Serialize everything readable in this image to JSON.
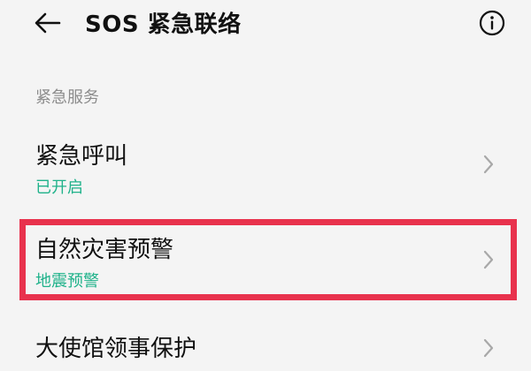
{
  "header": {
    "title": "SOS 紧急联络",
    "back_icon": "arrow-left-icon",
    "info_icon": "info-circle-icon"
  },
  "section": {
    "label": "紧急服务"
  },
  "items": [
    {
      "title": "紧急呼叫",
      "subtitle": "已开启",
      "icon": "chevron-right-icon"
    },
    {
      "title": "自然灾害预警",
      "subtitle": "地震预警",
      "icon": "chevron-right-icon",
      "highlighted": true
    },
    {
      "title": "大使馆领事保护",
      "icon": "chevron-right-icon"
    }
  ],
  "colors": {
    "background": "#f4f4f4",
    "subtitle_green": "#1fb28a",
    "highlight_red": "#e8324d",
    "section_gray": "#8c8c8c"
  }
}
